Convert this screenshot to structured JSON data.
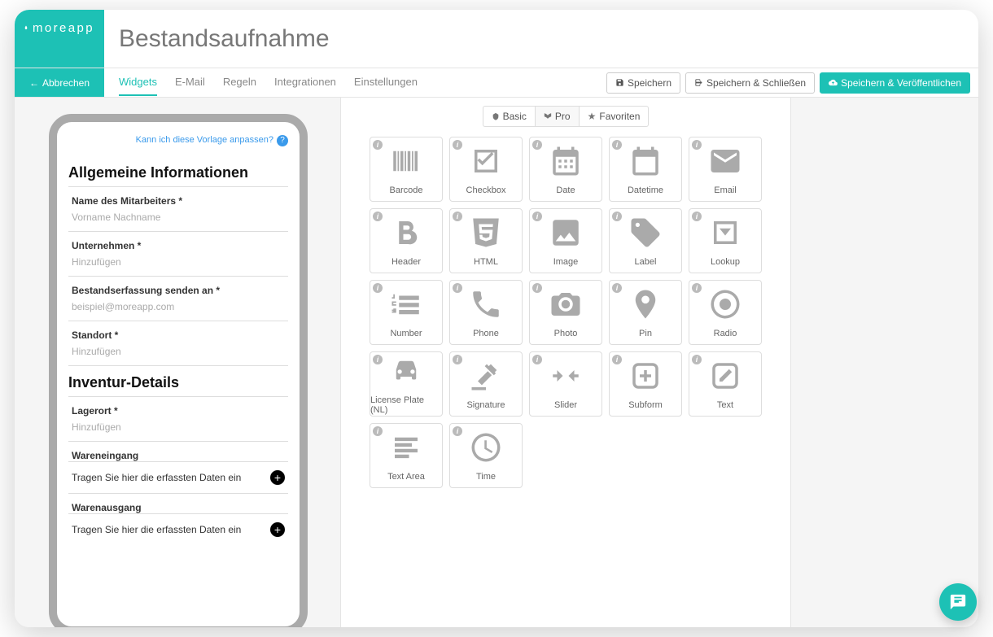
{
  "brand": "moreapp",
  "page_title": "Bestandsaufnahme",
  "cancel_label": "Abbrechen",
  "tabs": [
    "Widgets",
    "E-Mail",
    "Regeln",
    "Integrationen",
    "Einstellungen"
  ],
  "active_tab": 0,
  "actions": {
    "save": "Speichern",
    "save_close": "Speichern & Schließen",
    "save_publish": "Speichern & Veröffentlichen"
  },
  "help_text": "Kann ich diese Vorlage anpassen?",
  "form": {
    "section1": "Allgemeine Informationen",
    "fields1": [
      {
        "label": "Name des Mitarbeiters *",
        "placeholder": "Vorname Nachname"
      },
      {
        "label": "Unternehmen *",
        "placeholder": "Hinzufügen"
      },
      {
        "label": "Bestandserfassung senden an *",
        "placeholder": "beispiel@moreapp.com"
      },
      {
        "label": "Standort *",
        "placeholder": "Hinzufügen"
      }
    ],
    "section2": "Inventur-Details",
    "field_lager_label": "Lagerort *",
    "field_lager_placeholder": "Hinzufügen",
    "wareneingang": "Wareneingang",
    "warenausgang": "Warenausgang",
    "subtext": "Tragen Sie hier die erfassten Daten ein"
  },
  "filters": {
    "basic": "Basic",
    "pro": "Pro",
    "fav": "Favoriten"
  },
  "widgets": [
    {
      "name": "Barcode",
      "icon": "barcode"
    },
    {
      "name": "Checkbox",
      "icon": "checkbox"
    },
    {
      "name": "Date",
      "icon": "calendar-grid"
    },
    {
      "name": "Datetime",
      "icon": "calendar"
    },
    {
      "name": "Email",
      "icon": "envelope"
    },
    {
      "name": "Header",
      "icon": "bold"
    },
    {
      "name": "HTML",
      "icon": "html5"
    },
    {
      "name": "Image",
      "icon": "image"
    },
    {
      "name": "Label",
      "icon": "tag"
    },
    {
      "name": "Lookup",
      "icon": "dropdown"
    },
    {
      "name": "Number",
      "icon": "numlist"
    },
    {
      "name": "Phone",
      "icon": "phone"
    },
    {
      "name": "Photo",
      "icon": "camera"
    },
    {
      "name": "Pin",
      "icon": "pin"
    },
    {
      "name": "Radio",
      "icon": "radio"
    },
    {
      "name": "License Plate (NL)",
      "icon": "car"
    },
    {
      "name": "Signature",
      "icon": "gavel"
    },
    {
      "name": "Slider",
      "icon": "slider"
    },
    {
      "name": "Subform",
      "icon": "plus-square"
    },
    {
      "name": "Text",
      "icon": "edit"
    },
    {
      "name": "Text Area",
      "icon": "lines"
    },
    {
      "name": "Time",
      "icon": "clock"
    }
  ]
}
